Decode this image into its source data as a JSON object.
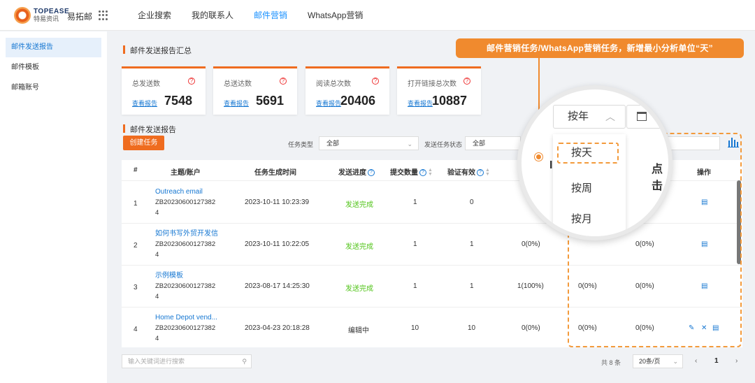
{
  "header": {
    "logo_en": "TOPEASE",
    "logo_cn": "特易资讯",
    "app_name": "易拓邮",
    "nav": [
      "企业搜索",
      "我的联系人",
      "邮件营销",
      "WhatsApp营销"
    ],
    "nav_active_index": 2
  },
  "sidebar": {
    "items": [
      "邮件发送报告",
      "邮件模板",
      "邮箱账号"
    ],
    "active_index": 0
  },
  "summary": {
    "title": "邮件发送报告汇总",
    "cards": [
      {
        "label": "总发送数",
        "link": "查看报告",
        "value": "7548"
      },
      {
        "label": "总送达数",
        "link": "查看报告",
        "value": "5691"
      },
      {
        "label": "阅读总次数",
        "link": "查看报告",
        "value": "20406"
      },
      {
        "label": "打开链接总次数",
        "link": "查看报告",
        "value": "10887"
      }
    ]
  },
  "report": {
    "title": "邮件发送报告",
    "create_button": "创建任务",
    "filters": {
      "task_type_label": "任务类型",
      "task_type_value": "全部",
      "send_status_label": "发送任务状态",
      "send_status_value": "全部"
    }
  },
  "table": {
    "headers": {
      "index": "#",
      "subject": "主题/账户",
      "time": "任务生成时间",
      "progress": "发送进度",
      "submitted": "提交数量",
      "verified": "验证有效",
      "ops": "操作"
    },
    "rows": [
      {
        "index": "1",
        "title": "Outreach email",
        "account1": "ZB20230600127382",
        "account2": "4",
        "time": "2023-10-11 10:23:39",
        "status": "发送完成",
        "submitted": "1",
        "verified": "0",
        "c1": "",
        "c2": "",
        "c3": ""
      },
      {
        "index": "2",
        "title": "如何书写外贸开发信",
        "account1": "ZB20230600127382",
        "account2": "4",
        "time": "2023-10-11 10:22:05",
        "status": "发送完成",
        "submitted": "1",
        "verified": "1",
        "c1": "0(0%)",
        "c2": "",
        "c3": "0(0%)"
      },
      {
        "index": "3",
        "title": "示例模板",
        "account1": "ZB20230600127382",
        "account2": "4",
        "time": "2023-08-17 14:25:30",
        "status": "发送完成",
        "submitted": "1",
        "verified": "1",
        "c1": "1(100%)",
        "c2": "0(0%)",
        "c3": "0(0%)"
      },
      {
        "index": "4",
        "title": "Home Depot vend...",
        "account1": "ZB20230600127382",
        "account2": "4",
        "time": "2023-04-23 20:18:28",
        "status": "编辑中",
        "submitted": "10",
        "verified": "10",
        "c1": "0(0%)",
        "c2": "0(0%)",
        "c3": "0(0%)"
      }
    ]
  },
  "footer": {
    "search_placeholder": "输入关键词进行搜索",
    "total": "共 8 条",
    "page_size": "20条/页",
    "prev": "‹",
    "page": "1",
    "next": "›"
  },
  "annotation": {
    "callout": "邮件营销任务/WhatsApp营销任务，新增最小分析单位“天”",
    "magnifier": {
      "selected": "按年",
      "options": [
        "按天",
        "按周",
        "按月"
      ],
      "partial_header": "点击"
    }
  },
  "colors": {
    "accent_orange": "#ef6c1f",
    "link_blue": "#1677d2",
    "success_green": "#52c41a"
  }
}
